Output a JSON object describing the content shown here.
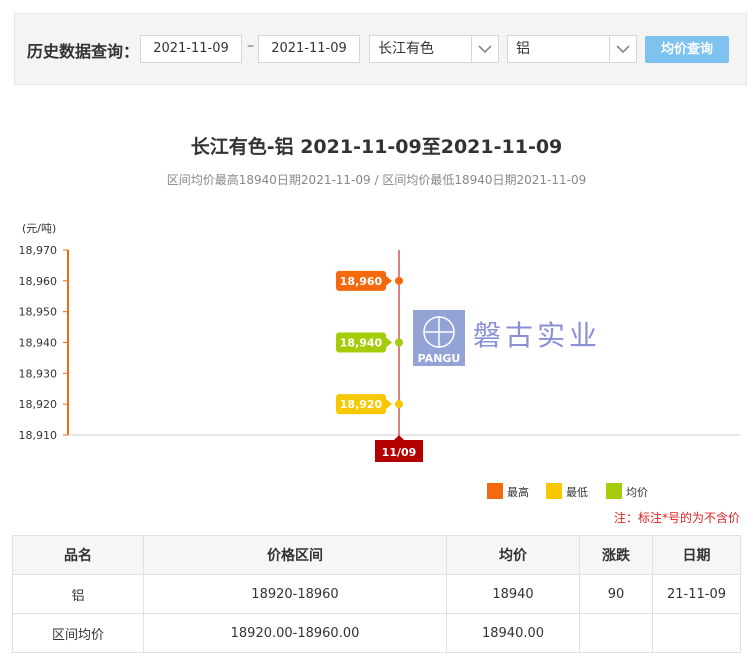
{
  "query": {
    "label": "历史数据查询：",
    "start_date": "2021-11-09",
    "dash": "–",
    "end_date": "2021-11-09",
    "market": "长江有色",
    "metal": "铝",
    "button": "均价查询"
  },
  "chart": {
    "title": "长江有色-铝 2021-11-09至2021-11-09",
    "subtitle": "区间均价最高18940日期2021-11-09 / 区间均价最低18940日期2021-11-09",
    "watermark_logo": "PANGU",
    "watermark_text": "磐古实业"
  },
  "chart_data": {
    "type": "line",
    "ylabel": "(元/吨)",
    "ylim": [
      18910,
      18970
    ],
    "yticks": [
      "18,970",
      "18,960",
      "18,950",
      "18,940",
      "18,930",
      "18,920",
      "18,910"
    ],
    "categories": [
      "11/09"
    ],
    "series": [
      {
        "name": "最高",
        "values": [
          18960
        ],
        "labels": [
          "18,960"
        ],
        "color": "#f26a0d"
      },
      {
        "name": "均价",
        "values": [
          18940
        ],
        "labels": [
          "18,940"
        ],
        "color": "#a5cc0a"
      },
      {
        "name": "最低",
        "values": [
          18920
        ],
        "labels": [
          "18,920"
        ],
        "color": "#f5c800"
      }
    ],
    "legend": [
      {
        "label": "最高",
        "color": "#f26a0d"
      },
      {
        "label": "最低",
        "color": "#f5c800"
      },
      {
        "label": "均价",
        "color": "#a5cc0a"
      }
    ],
    "legend_position": "bottom-right",
    "crosshair_color": "#b40000"
  },
  "note": "注：标注*号的为不含价",
  "table": {
    "headers": [
      "品名",
      "价格区间",
      "均价",
      "涨跌",
      "日期"
    ],
    "rows": [
      [
        "铝",
        "18920-18960",
        "18940",
        "90",
        "21-11-09"
      ],
      [
        "区间均价",
        "18920.00-18960.00",
        "18940.00",
        "",
        ""
      ]
    ]
  }
}
